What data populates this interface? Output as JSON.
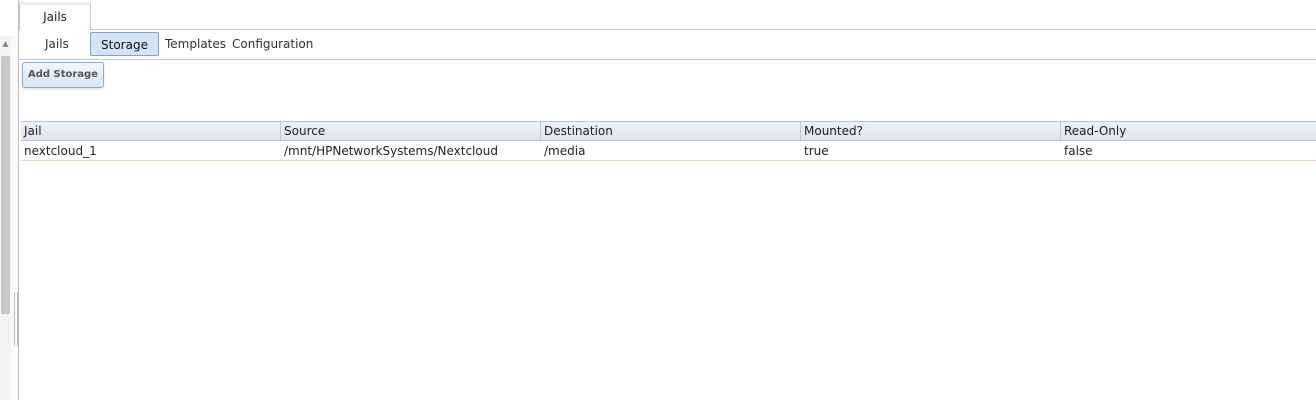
{
  "top_tabs": [
    {
      "label": "Jails",
      "active": true
    }
  ],
  "sub_tabs": [
    {
      "label": "Jails",
      "active": false
    },
    {
      "label": "Storage",
      "active": true
    },
    {
      "label": "Templates",
      "active": false
    },
    {
      "label": "Configuration",
      "active": false
    }
  ],
  "toolbar": {
    "add_storage_label": "Add Storage"
  },
  "table": {
    "columns": [
      "Jail",
      "Source",
      "Destination",
      "Mounted?",
      "Read-Only"
    ],
    "rows": [
      [
        "nextcloud_1",
        "/mnt/HPNetworkSystems/Nextcloud",
        "/media",
        "true",
        "false"
      ]
    ]
  },
  "colors": {
    "active_tab_bg": "#d2e4f7",
    "active_tab_border": "#7ea3c8",
    "header_bg": "#dde5ef",
    "row_border": "#f0d6b8"
  },
  "icons": {
    "scroll_up": "triangle-up-icon"
  }
}
